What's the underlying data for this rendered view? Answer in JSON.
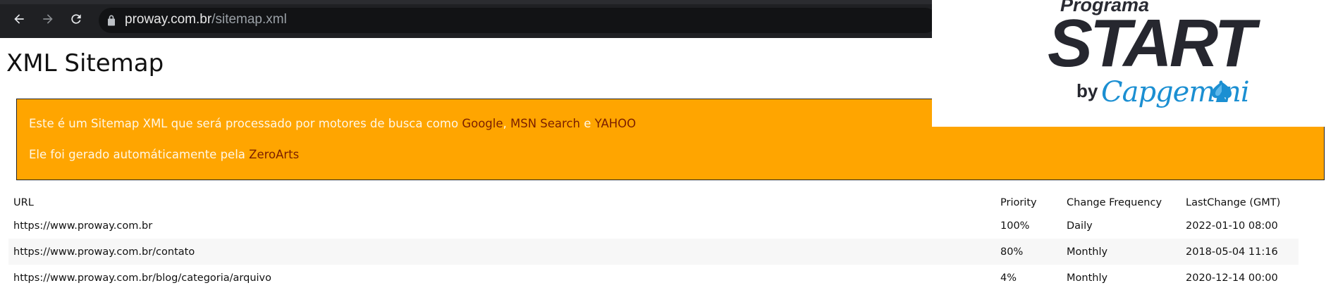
{
  "browser": {
    "url_domain": "proway.com.br",
    "url_path": "/sitemap.xml"
  },
  "page": {
    "title": "XML Sitemap"
  },
  "info": {
    "line1_prefix": "Este é um Sitemap XML que será processado por motores de busca como ",
    "link_google": "Google",
    "sep1": ", ",
    "link_msn": "MSN Search",
    "sep2": " e ",
    "link_yahoo": "YAHOO",
    "line2_prefix": "Ele foi gerado automáticamente pela ",
    "link_zeroarts": "ZeroArts"
  },
  "table": {
    "headers": {
      "url": "URL",
      "priority": "Priority",
      "frequency": "Change Frequency",
      "lastchange": "LastChange (GMT)"
    },
    "rows": [
      {
        "url": "https://www.proway.com.br",
        "priority": "100%",
        "frequency": "Daily",
        "lastchange": "2022-01-10 08:00"
      },
      {
        "url": "https://www.proway.com.br/contato",
        "priority": "80%",
        "frequency": "Monthly",
        "lastchange": "2018-05-04 11:16"
      },
      {
        "url": "https://www.proway.com.br/blog/categoria/arquivo",
        "priority": "4%",
        "frequency": "Monthly",
        "lastchange": "2020-12-14 00:00"
      }
    ]
  },
  "overlay": {
    "programa": "Programa",
    "start": "START",
    "by": "by",
    "brand": "Capgemini"
  },
  "icons": {
    "back": "arrow-left-icon",
    "forward": "arrow-right-icon",
    "reload": "reload-icon",
    "lock": "lock-icon",
    "spade": "capgemini-spade-icon"
  },
  "colors": {
    "info_bg": "#ffa500",
    "link": "#7a1f00",
    "brand_blue": "#1b8fd2"
  }
}
